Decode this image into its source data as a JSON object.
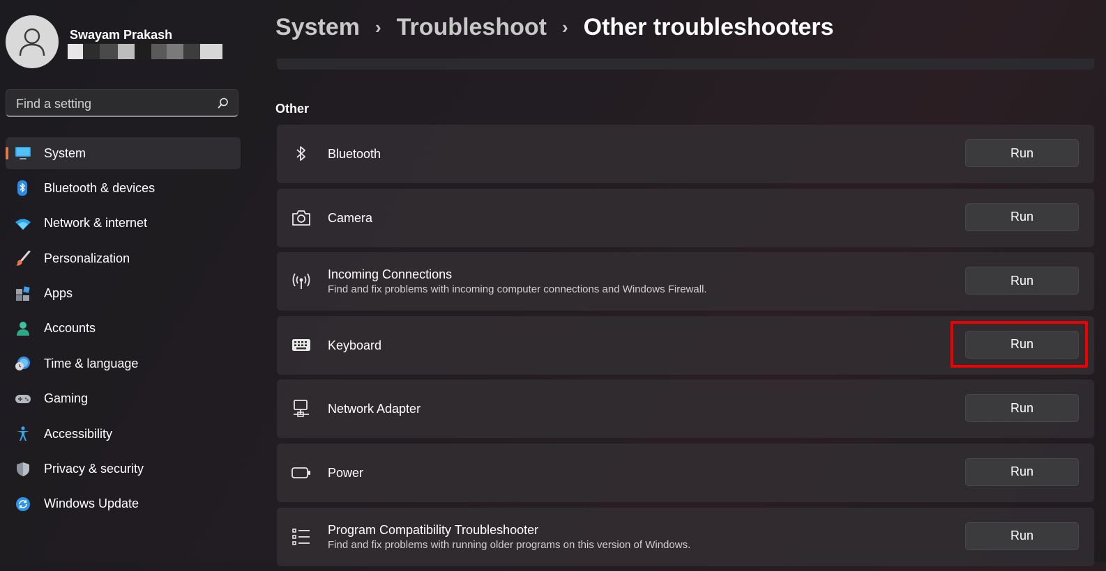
{
  "user": {
    "name": "Swayam Prakash"
  },
  "search": {
    "placeholder": "Find a setting"
  },
  "sidebar": {
    "items": [
      {
        "label": "System",
        "icon": "monitor-icon",
        "active": true
      },
      {
        "label": "Bluetooth & devices",
        "icon": "bluetooth-devices-icon"
      },
      {
        "label": "Network & internet",
        "icon": "wifi-icon"
      },
      {
        "label": "Personalization",
        "icon": "brush-icon"
      },
      {
        "label": "Apps",
        "icon": "apps-icon"
      },
      {
        "label": "Accounts",
        "icon": "account-icon"
      },
      {
        "label": "Time & language",
        "icon": "clock-globe-icon"
      },
      {
        "label": "Gaming",
        "icon": "gamepad-icon"
      },
      {
        "label": "Accessibility",
        "icon": "accessibility-icon"
      },
      {
        "label": "Privacy & security",
        "icon": "shield-icon"
      },
      {
        "label": "Windows Update",
        "icon": "update-icon"
      }
    ]
  },
  "breadcrumb": {
    "level1": "System",
    "level2": "Troubleshoot",
    "current": "Other troubleshooters",
    "separator": "›"
  },
  "section": {
    "title": "Other"
  },
  "troubleshooters": [
    {
      "title": "Bluetooth",
      "description": "",
      "icon": "bluetooth-icon",
      "run_label": "Run"
    },
    {
      "title": "Camera",
      "description": "",
      "icon": "camera-icon",
      "run_label": "Run"
    },
    {
      "title": "Incoming Connections",
      "description": "Find and fix problems with incoming computer connections and Windows Firewall.",
      "icon": "antenna-icon",
      "run_label": "Run"
    },
    {
      "title": "Keyboard",
      "description": "",
      "icon": "keyboard-icon",
      "run_label": "Run"
    },
    {
      "title": "Network Adapter",
      "description": "",
      "icon": "network-adapter-icon",
      "run_label": "Run"
    },
    {
      "title": "Power",
      "description": "",
      "icon": "battery-icon",
      "run_label": "Run"
    },
    {
      "title": "Program Compatibility Troubleshooter",
      "description": "Find and fix problems with running older programs on this version of Windows.",
      "icon": "list-icon",
      "run_label": "Run"
    }
  ],
  "colors": {
    "accent": "#e8764b",
    "highlight": "#ee0000",
    "card": "#343034",
    "button": "#3b3a3d"
  }
}
